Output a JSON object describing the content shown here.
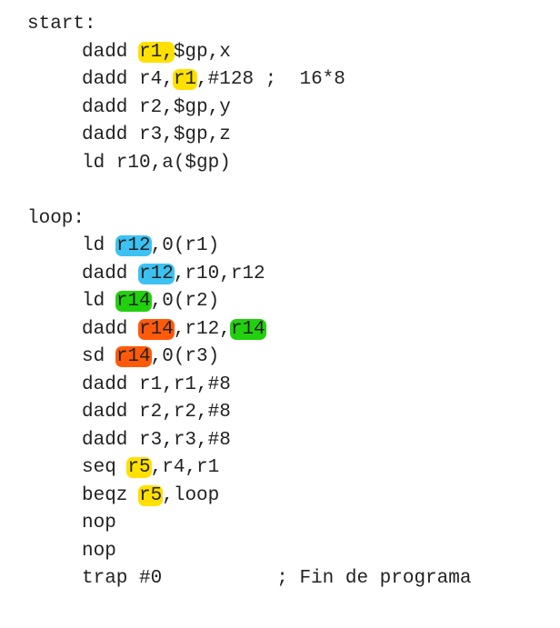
{
  "colors": {
    "yellow": "#ffe000",
    "blue": "#3cc2f2",
    "green": "#22d10d",
    "orange": "#ff5a0a",
    "text": "#222222"
  },
  "lines": [
    {
      "indent": false,
      "parts": [
        {
          "t": "start:"
        }
      ]
    },
    {
      "indent": true,
      "parts": [
        {
          "t": "dadd "
        },
        {
          "t": "r1,",
          "hl": "yellow"
        },
        {
          "t": "$gp,x"
        }
      ]
    },
    {
      "indent": true,
      "parts": [
        {
          "t": "dadd r4,"
        },
        {
          "t": "r1",
          "hl": "yellow"
        },
        {
          "t": ",#128 ;  16*8"
        }
      ]
    },
    {
      "indent": true,
      "parts": [
        {
          "t": "dadd r2,$gp,y"
        }
      ]
    },
    {
      "indent": true,
      "parts": [
        {
          "t": "dadd r3,$gp,z"
        }
      ]
    },
    {
      "indent": true,
      "parts": [
        {
          "t": "ld r10,a($gp)"
        }
      ]
    },
    {
      "blank": true
    },
    {
      "indent": false,
      "parts": [
        {
          "t": "loop:"
        }
      ]
    },
    {
      "indent": true,
      "parts": [
        {
          "t": "ld "
        },
        {
          "t": "r12",
          "hl": "blue"
        },
        {
          "t": ",0(r1)"
        }
      ]
    },
    {
      "indent": true,
      "parts": [
        {
          "t": "dadd "
        },
        {
          "t": "r12",
          "hl": "blue"
        },
        {
          "t": ",r10,r12"
        }
      ]
    },
    {
      "indent": true,
      "parts": [
        {
          "t": "ld "
        },
        {
          "t": "r14",
          "hl": "green"
        },
        {
          "t": ",0(r2)"
        }
      ]
    },
    {
      "indent": true,
      "parts": [
        {
          "t": "dadd "
        },
        {
          "t": "r14",
          "hl": "orange"
        },
        {
          "t": ",r12,"
        },
        {
          "t": "r14",
          "hl": "green"
        }
      ]
    },
    {
      "indent": true,
      "parts": [
        {
          "t": "sd "
        },
        {
          "t": "r14",
          "hl": "orange"
        },
        {
          "t": ",0(r3)"
        }
      ]
    },
    {
      "indent": true,
      "parts": [
        {
          "t": "dadd r1,r1,#8"
        }
      ]
    },
    {
      "indent": true,
      "parts": [
        {
          "t": "dadd r2,r2,#8"
        }
      ]
    },
    {
      "indent": true,
      "parts": [
        {
          "t": "dadd r3,r3,#8"
        }
      ]
    },
    {
      "indent": true,
      "parts": [
        {
          "t": "seq "
        },
        {
          "t": "r5",
          "hl": "yellow"
        },
        {
          "t": ",r4,r1"
        }
      ]
    },
    {
      "indent": true,
      "parts": [
        {
          "t": "beqz "
        },
        {
          "t": "r5",
          "hl": "yellow"
        },
        {
          "t": ",loop"
        }
      ]
    },
    {
      "indent": true,
      "parts": [
        {
          "t": "nop"
        }
      ]
    },
    {
      "indent": true,
      "parts": [
        {
          "t": "nop"
        }
      ]
    },
    {
      "indent": true,
      "parts": [
        {
          "t": "trap #0          ; Fin de programa"
        }
      ]
    }
  ]
}
